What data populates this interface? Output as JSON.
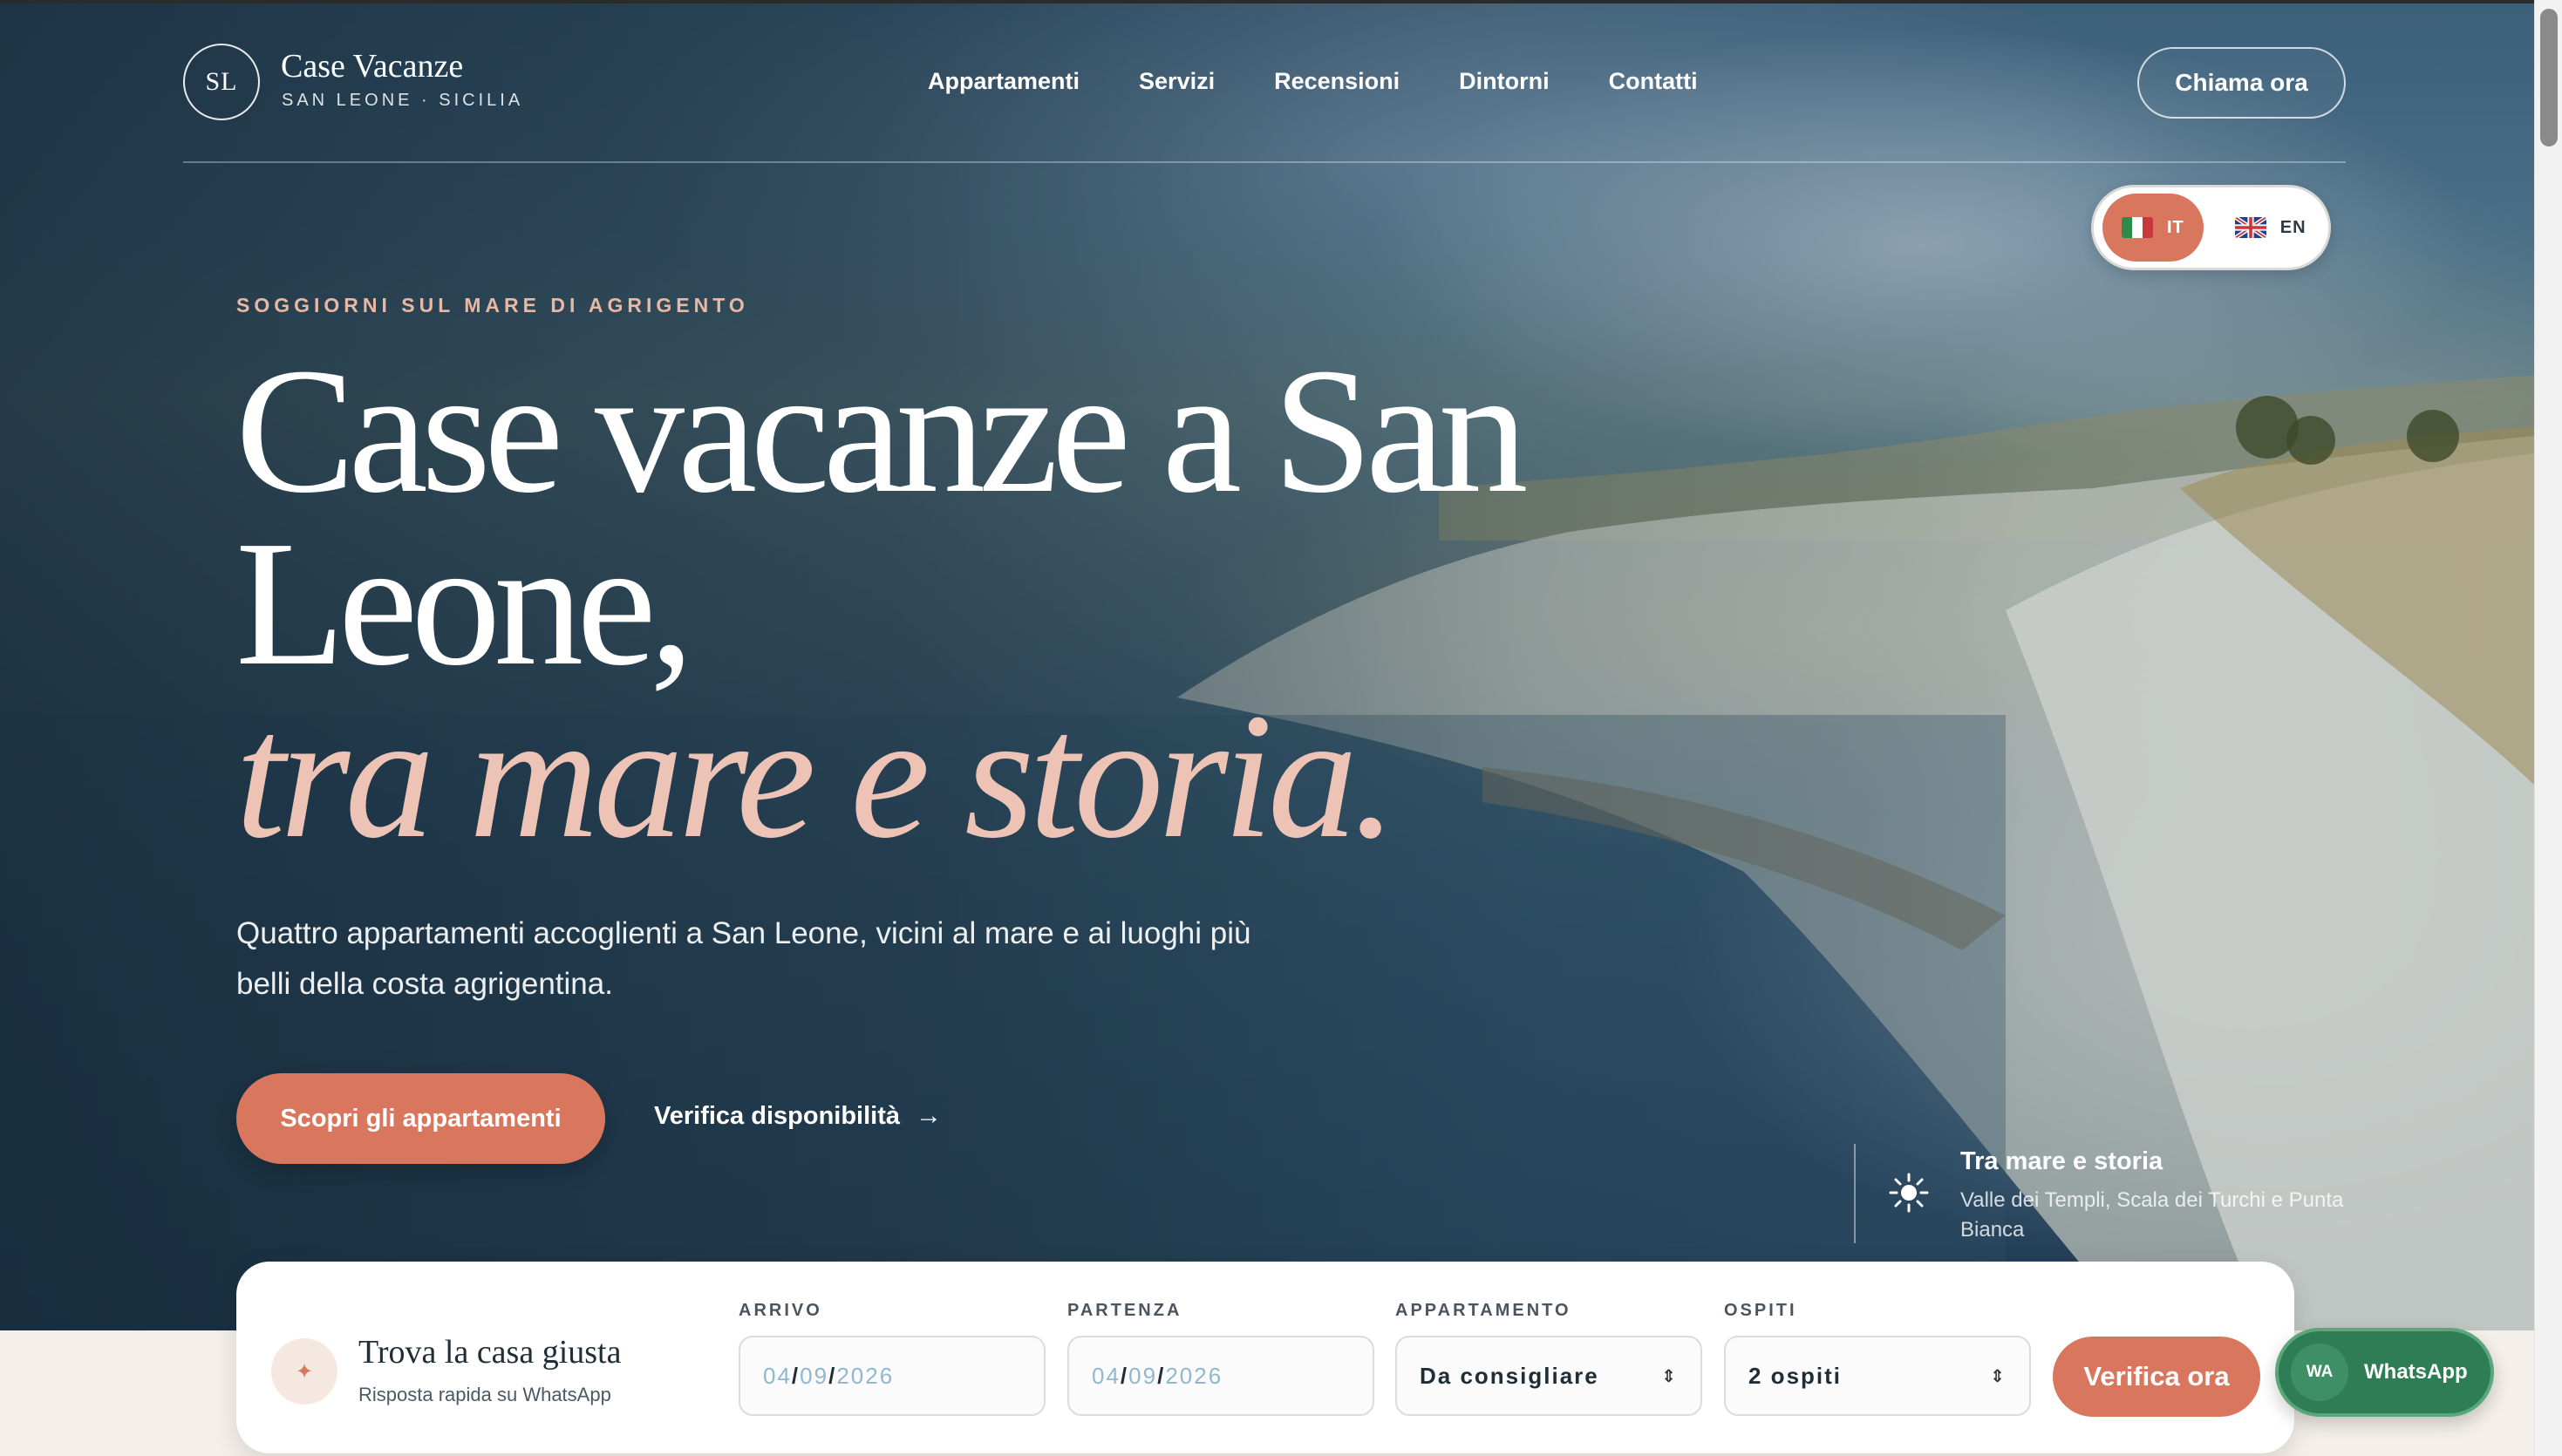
{
  "brand": {
    "initials": "SL",
    "title": "Case Vacanze",
    "subtitle": "SAN LEONE · SICILIA"
  },
  "nav": {
    "items": [
      "Appartamenti",
      "Servizi",
      "Recensioni",
      "Dintorni",
      "Contatti"
    ],
    "call_label": "Chiama ora"
  },
  "language": {
    "active": "IT",
    "other": "EN"
  },
  "hero": {
    "eyebrow": "SOGGIORNI SUL MARE DI AGRIGENTO",
    "title_line1": "Case vacanze a San",
    "title_line2": "Leone,",
    "title_italic": "tra mare e storia.",
    "lead": "Quattro appartamenti accoglienti a San Leone, vicini al mare e ai luoghi più belli della costa agrigentina.",
    "primary_cta": "Scopri gli appartamenti",
    "secondary_cta": "Verifica disponibilità"
  },
  "side_info": {
    "title": "Tra mare e storia",
    "text": "Valle dei Templi, Scala dei Turchi e Punta Bianca"
  },
  "booking": {
    "title": "Trova la casa giusta",
    "subtitle": "Risposta rapida su WhatsApp",
    "arrival_label": "ARRIVO",
    "departure_label": "PARTENZA",
    "apartment_label": "APPARTAMENTO",
    "guests_label": "OSPITI",
    "arrival": {
      "dd": "04",
      "mm": "09",
      "yyyy": "2026",
      "sep": "/"
    },
    "departure": {
      "dd": "04",
      "mm": "09",
      "yyyy": "2026",
      "sep": "/"
    },
    "apartment_value": "Da consigliare",
    "guests_value": "2 ospiti",
    "submit_label": "Verifica ora"
  },
  "whatsapp": {
    "icon_text": "WA",
    "label": "WhatsApp"
  },
  "colors": {
    "accent": "#d9765e",
    "accent_soft": "#edc3b5",
    "whatsapp": "#2e7d54"
  }
}
